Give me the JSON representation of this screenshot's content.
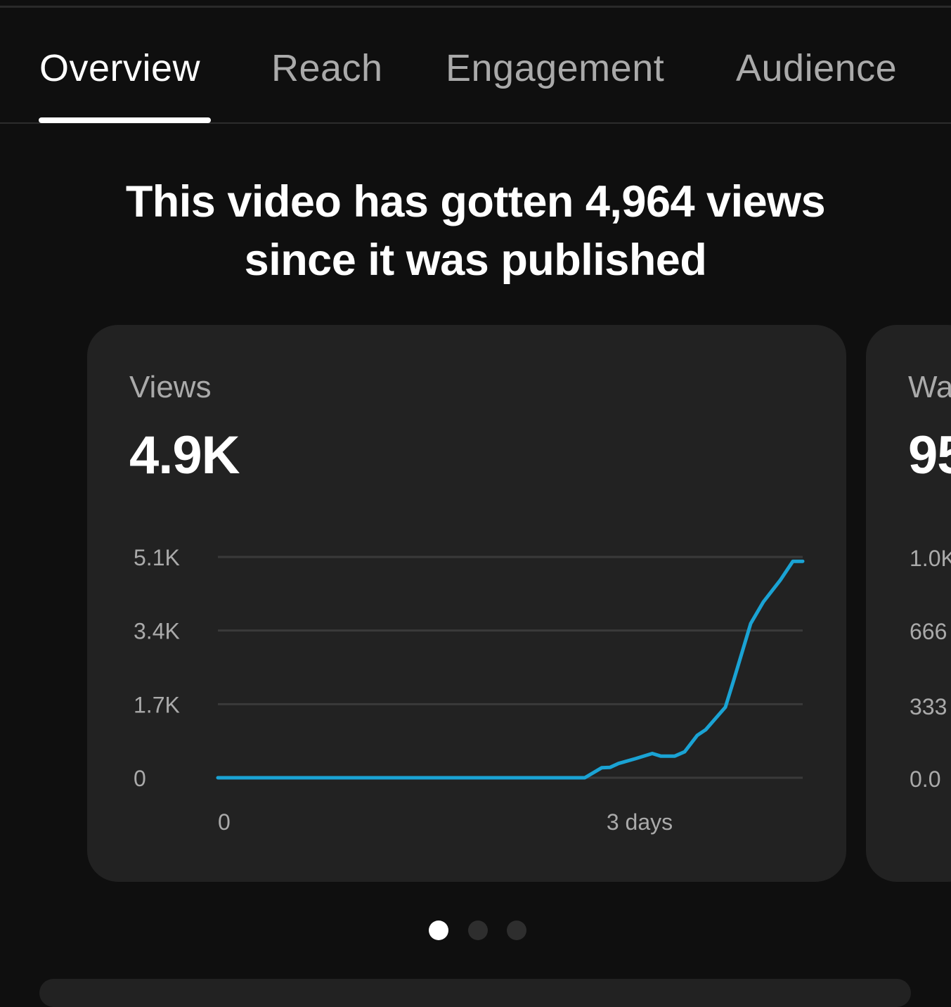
{
  "tabs": [
    {
      "label": "Overview",
      "active": true
    },
    {
      "label": "Reach",
      "active": false
    },
    {
      "label": "Engagement",
      "active": false
    },
    {
      "label": "Audience",
      "active": false
    }
  ],
  "headline": {
    "line1": "This video has gotten 4,964 views",
    "line2": "since it was published"
  },
  "cards": [
    {
      "label": "Views",
      "value": "4.9K",
      "y_ticks": [
        "5.1K",
        "3.4K",
        "1.7K",
        "0"
      ],
      "x_ticks": [
        "0",
        "3 days"
      ]
    },
    {
      "label": "Wa",
      "value": "95",
      "y_ticks": [
        "1.0K",
        "666",
        "333",
        "0.0"
      ]
    }
  ],
  "pagination": {
    "count": 3,
    "active_index": 0
  },
  "colors": {
    "background": "#0f0f0f",
    "card": "#222222",
    "line": "#1aa3d4",
    "gridline": "#3a3a3a"
  },
  "chart_data": {
    "type": "line",
    "title": "Views",
    "xlabel": "",
    "ylabel": "",
    "x_unit": "days",
    "x_ticks": [
      {
        "label": "0",
        "value": 0
      },
      {
        "label": "3 days",
        "value": 3
      }
    ],
    "y_ticks": [
      {
        "label": "0",
        "value": 0
      },
      {
        "label": "1.7K",
        "value": 1700
      },
      {
        "label": "3.4K",
        "value": 3400
      },
      {
        "label": "5.1K",
        "value": 5100
      }
    ],
    "ylim": [
      0,
      5100
    ],
    "grid": true,
    "series": [
      {
        "x": [
          0,
          2.61,
          2.73,
          2.79,
          2.85,
          2.97,
          3.09,
          3.15,
          3.25,
          3.32,
          3.41,
          3.47,
          3.61,
          3.67,
          3.79,
          3.88,
          4.0,
          4.09,
          4.16
        ],
        "y": [
          0,
          0,
          230,
          240,
          330,
          440,
          560,
          500,
          500,
          600,
          980,
          1110,
          1630,
          2260,
          3560,
          4060,
          4560,
          5000,
          5000
        ],
        "color": "#1aa3d4"
      }
    ]
  }
}
